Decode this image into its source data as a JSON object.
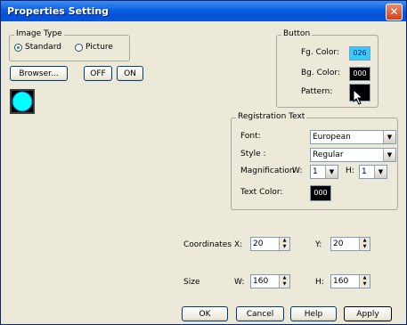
{
  "window": {
    "title": "Properties Setting",
    "close_glyph": "✕"
  },
  "image_type": {
    "legend": "Image Type",
    "options": [
      {
        "label": "Standard",
        "selected": true
      },
      {
        "label": "Picture",
        "selected": false
      }
    ]
  },
  "browser_label": "Browser...",
  "state_buttons": {
    "off": "OFF",
    "on": "ON"
  },
  "preview": {
    "shape": "circle",
    "fill": "#00ffff"
  },
  "button_group": {
    "legend": "Button",
    "fg_label": "Fg. Color:",
    "fg_value": "026",
    "fg_color": "#33ccff",
    "bg_label": "Bg. Color:",
    "bg_value": "000",
    "bg_color": "#000000",
    "pattern_label": "Pattern:",
    "pattern_color": "#000000"
  },
  "registration": {
    "legend": "Registration Text",
    "font_label": "Font:",
    "font_value": "European",
    "style_label": "Style :",
    "style_value": "Regular",
    "magnification_label": "Magnification",
    "w_label": "W:",
    "w_value": "1",
    "h_label": "H:",
    "h_value": "1",
    "text_color_label": "Text Color:",
    "text_color_value": "000",
    "text_color": "#000000"
  },
  "coordinates": {
    "label": "Coordinates",
    "x_label": "X:",
    "x_value": "20",
    "y_label": "Y:",
    "y_value": "20"
  },
  "size": {
    "label": "Size",
    "w_label": "W:",
    "w_value": "160",
    "h_label": "H:",
    "h_value": "160"
  },
  "footer": {
    "ok": "OK",
    "cancel": "Cancel",
    "help": "Help",
    "apply": "Apply"
  },
  "icons": {
    "close": "close-icon",
    "dropdown": "chevron-down-icon",
    "spinner": "spinner-icon",
    "cursor": "mouse-cursor-icon"
  }
}
